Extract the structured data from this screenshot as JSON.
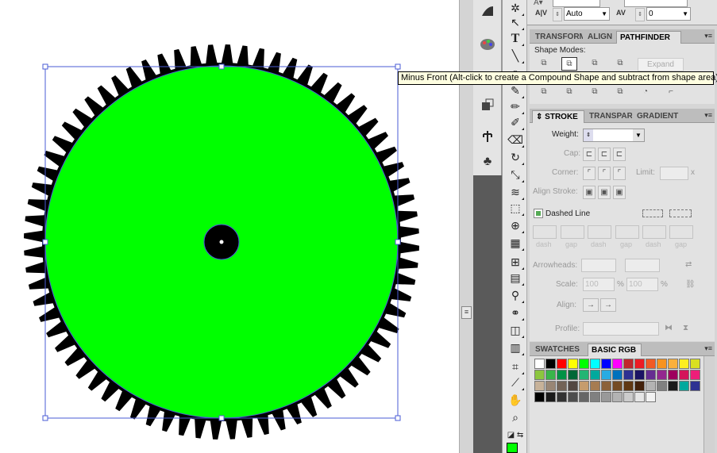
{
  "tooltip": "Minus Front (Alt-click to create a Compound Shape and subtract from shape area)",
  "artwork": {
    "outer_color": "#000000",
    "inner_color": "#00ff00",
    "selection_color": "#4a5bd6"
  },
  "char_panel": {
    "kerning_value": "Auto",
    "tracking_value": "0"
  },
  "transform_tabs": [
    {
      "label": "TRANSFORM"
    },
    {
      "label": "ALIGN"
    },
    {
      "label": "PATHFINDER"
    }
  ],
  "pathfinder": {
    "shape_modes_label": "Shape Modes:",
    "expand_label": "Expand"
  },
  "stroke_tabs": [
    {
      "label": "STROKE"
    },
    {
      "label": "TRANSPAR"
    },
    {
      "label": "GRADIENT"
    }
  ],
  "stroke": {
    "weight_label": "Weight:",
    "cap_label": "Cap:",
    "corner_label": "Corner:",
    "limit_label": "Limit:",
    "limit_unit": "x",
    "align_label": "Align Stroke:",
    "dashed_label": "Dashed Line",
    "dash_caps": [
      "dash",
      "gap",
      "dash",
      "gap",
      "dash",
      "gap"
    ],
    "arrowheads_label": "Arrowheads:",
    "scale_label": "Scale:",
    "scale_start": "100",
    "scale_end": "100",
    "percent": "%",
    "align_arrows_label": "Align:",
    "profile_label": "Profile:"
  },
  "swatch_tabs": [
    {
      "label": "SWATCHES"
    },
    {
      "label": "BASIC RGB"
    }
  ],
  "swatches": {
    "row1": [
      "#ffffff",
      "#000000",
      "#ff0000",
      "#ffff00",
      "#00ff00",
      "#00ffff",
      "#0000ff",
      "#ff00ff",
      "#c1272d",
      "#ed1c24",
      "#f15a24",
      "#f7931e",
      "#fbb03b",
      "#fcee21",
      "#d9e021"
    ],
    "row2": [
      "#8cc63f",
      "#39b54a",
      "#009245",
      "#006837",
      "#22b573",
      "#00a99d",
      "#29abe2",
      "#0071bc",
      "#2e3192",
      "#1b1464",
      "#662d91",
      "#93278f",
      "#9e005d",
      "#d4145a",
      "#ed1e79"
    ],
    "row3": [
      "#c7b299",
      "#998675",
      "#736357",
      "#534741",
      "#c69c6d",
      "#a67c52",
      "#8c6239",
      "#754c24",
      "#603813",
      "#42210b",
      "#b3b3b3",
      "#808080",
      "#1a1a1a",
      "#00a99d",
      "#2e3192"
    ],
    "row4": [
      "#000000",
      "#1a1a1a",
      "#333333",
      "#4d4d4d",
      "#666666",
      "#808080",
      "#999999",
      "#b3b3b3",
      "#cccccc",
      "#e6e6e6",
      "#f2f2f2"
    ]
  }
}
